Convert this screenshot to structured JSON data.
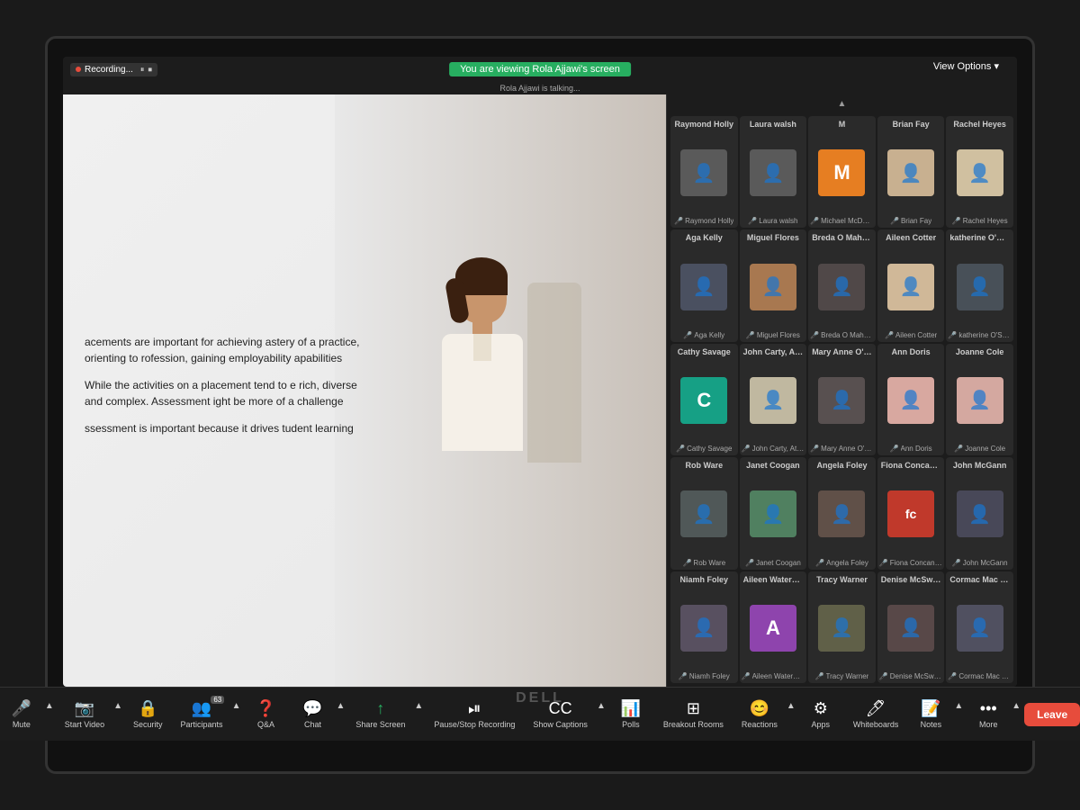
{
  "monitor": {
    "recording": "Recording...",
    "viewing_banner": "You are viewing Rola Ajjawi's screen",
    "talking": "Rola Ajjawi is talking...",
    "view_options": "View Options"
  },
  "slide": {
    "bullets": [
      "acements are important for achieving astery of a practice, orienting to rofession, gaining employability apabilities",
      "While the activities on a placement tend to e rich, diverse and complex. Assessment ight be more of a challenge",
      "ssessment is important because it drives tudent learning"
    ]
  },
  "participants": [
    {
      "id": 1,
      "top_name": "Raymond Holly",
      "bottom_name": "Raymond Holly",
      "avatar_type": "photo_gray",
      "avatar_text": ""
    },
    {
      "id": 2,
      "top_name": "Laura walsh",
      "bottom_name": "Laura walsh",
      "avatar_type": "photo_gray",
      "avatar_text": ""
    },
    {
      "id": 3,
      "top_name": "M",
      "bottom_name": "Michael McDonnell",
      "avatar_type": "letter",
      "color": "av-orange",
      "avatar_text": "M"
    },
    {
      "id": 4,
      "top_name": "Brian Fay",
      "bottom_name": "Brian Fay",
      "avatar_type": "photo_brian",
      "avatar_text": ""
    },
    {
      "id": 5,
      "top_name": "Rachel Heyes",
      "bottom_name": "Rachel Heyes",
      "avatar_type": "photo_rachel",
      "avatar_text": ""
    },
    {
      "id": 6,
      "top_name": "Aga Kelly",
      "bottom_name": "Aga Kelly",
      "avatar_type": "photo_gray2",
      "avatar_text": ""
    },
    {
      "id": 7,
      "top_name": "Miguel Flores",
      "bottom_name": "Miguel Flores",
      "avatar_type": "photo_miguel",
      "avatar_text": ""
    },
    {
      "id": 8,
      "top_name": "Breda O Mahony",
      "bottom_name": "Breda O Mahony",
      "avatar_type": "photo_gray3",
      "avatar_text": ""
    },
    {
      "id": 9,
      "top_name": "Aileen Cotter",
      "bottom_name": "Aileen Cotter",
      "avatar_type": "photo_aileen",
      "avatar_text": ""
    },
    {
      "id": 10,
      "top_name": "katherine O'Sull...",
      "bottom_name": "katherine O'Sullivan",
      "avatar_type": "photo_gray4",
      "avatar_text": ""
    },
    {
      "id": 11,
      "top_name": "Cathy Savage",
      "bottom_name": "Cathy Savage",
      "avatar_type": "letter",
      "color": "av-teal",
      "avatar_text": "C"
    },
    {
      "id": 12,
      "top_name": "John Carty, Atlantic TU",
      "bottom_name": "John Carty, Atlantic TU",
      "avatar_type": "photo_johncarty",
      "avatar_text": ""
    },
    {
      "id": 13,
      "top_name": "Mary Anne O'Ca...",
      "bottom_name": "Mary Anne O'Carroll",
      "avatar_type": "photo_gray5",
      "avatar_text": ""
    },
    {
      "id": 14,
      "top_name": "Ann Doris",
      "bottom_name": "Ann Doris",
      "avatar_type": "photo_ann",
      "avatar_text": ""
    },
    {
      "id": 15,
      "top_name": "Joanne Cole",
      "bottom_name": "Joanne Cole",
      "avatar_type": "photo_gray6",
      "avatar_text": ""
    },
    {
      "id": 16,
      "top_name": "Rob Ware",
      "bottom_name": "Rob Ware",
      "avatar_type": "photo_gray7",
      "avatar_text": ""
    },
    {
      "id": 17,
      "top_name": "Janet Coogan",
      "bottom_name": "Janet Coogan",
      "avatar_type": "photo_gray8",
      "avatar_text": ""
    },
    {
      "id": 18,
      "top_name": "Angela Foley",
      "bottom_name": "Angela Foley",
      "avatar_type": "photo_gray9",
      "avatar_text": ""
    },
    {
      "id": 19,
      "top_name": "Fiona Concannon",
      "bottom_name": "Fiona Concannon",
      "avatar_type": "letter",
      "color": "av-fc",
      "avatar_text": "fc"
    },
    {
      "id": 20,
      "top_name": "John McGann",
      "bottom_name": "John McGann",
      "avatar_type": "photo_gray10",
      "avatar_text": ""
    },
    {
      "id": 21,
      "top_name": "Niamh Foley",
      "bottom_name": "Niamh Foley",
      "avatar_type": "photo_gray11",
      "avatar_text": ""
    },
    {
      "id": 22,
      "top_name": "Aileen Waterman",
      "bottom_name": "Aileen Waterman",
      "avatar_type": "letter",
      "color": "av-purple",
      "avatar_text": "A"
    },
    {
      "id": 23,
      "top_name": "Tracy Warner",
      "bottom_name": "Tracy Warner",
      "avatar_type": "photo_gray12",
      "avatar_text": ""
    },
    {
      "id": 24,
      "top_name": "Denise McSwee...",
      "bottom_name": "Denise McSweeney",
      "avatar_type": "photo_gray13",
      "avatar_text": ""
    },
    {
      "id": 25,
      "top_name": "Cormac Mac Sw...",
      "bottom_name": "Cormac Mac Sweeney",
      "avatar_type": "photo_gray14",
      "avatar_text": ""
    }
  ],
  "toolbar": {
    "mute_label": "Mute",
    "start_video_label": "Start Video",
    "security_label": "Security",
    "participants_label": "Participants",
    "participants_count": "63",
    "qa_label": "Q&A",
    "chat_label": "Chat",
    "share_screen_label": "Share Screen",
    "pause_stop_label": "Pause/Stop Recording",
    "show_captions_label": "Show Captions",
    "polls_label": "Polls",
    "breakout_rooms_label": "Breakout Rooms",
    "reactions_label": "Reactions",
    "apps_label": "Apps",
    "whiteboards_label": "Whiteboards",
    "notes_label": "Notes",
    "more_label": "More",
    "leave_label": "Leave"
  }
}
